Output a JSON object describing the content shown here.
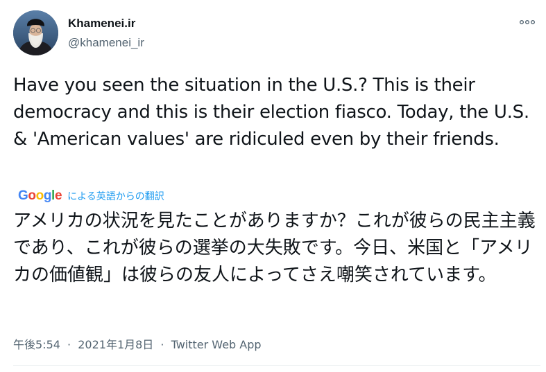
{
  "author": {
    "display_name": "Khamenei.ir",
    "handle": "@khamenei_ir"
  },
  "tweet": {
    "text": "Have you seen the situation in the U.S.? This is their democracy and this is their election fiasco. Today, the U.S. & 'American values' are ridiculed even by their friends.",
    "translation_provider": "Google",
    "translation_label": "による英語からの翻訳",
    "translated_text": "アメリカの状況を見たことがありますか？これが彼らの民主主義であり、これが彼らの選挙の大失敗です。今日、米国と「アメリカの価値観」は彼らの友人によってさえ嘲笑されています。",
    "time": "午後5:54",
    "date": "2021年1月8日",
    "separator": "·",
    "source": "Twitter Web App"
  },
  "icons": {
    "more": "more-horizontal-icon",
    "avatar": "avatar-portrait"
  },
  "colors": {
    "text_primary": "#0f1419",
    "text_secondary": "#536471",
    "link": "#1d9bf0",
    "google_blue": "#4285f4",
    "google_red": "#ea4335",
    "google_yellow": "#fbbc05",
    "google_green": "#34a853"
  }
}
